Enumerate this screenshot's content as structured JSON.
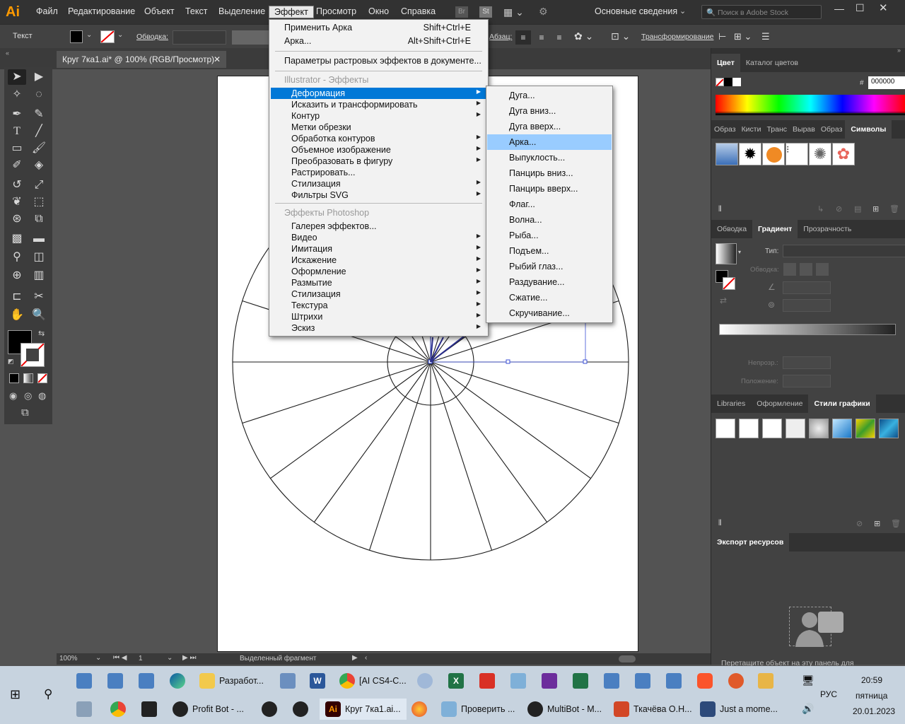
{
  "app": {
    "logo": "Ai"
  },
  "menubar": {
    "items": [
      "Файл",
      "Редактирование",
      "Объект",
      "Текст",
      "Выделение",
      "Эффект",
      "Просмотр",
      "Окно",
      "Справка"
    ],
    "workspace": "Основные сведения",
    "search_placeholder": "Поиск в Adobe Stock"
  },
  "control": {
    "mode_label": "Текст",
    "stroke_label": "Обводка:",
    "paragraph_label": "Абзац:",
    "transform_label": "Трансформирование"
  },
  "document": {
    "tab_title": "Круг 7ка1.ai* @ 100% (RGB/Просмотр)",
    "zoom": "100%",
    "page": "1",
    "status_text": "Выделенный фрагмент"
  },
  "effect_menu": {
    "apply_label": "Применить Арка",
    "apply_shortcut": "Shift+Ctrl+E",
    "last_label": "Арка...",
    "last_shortcut": "Alt+Shift+Ctrl+E",
    "raster_settings": "Параметры растровых эффектов в документе...",
    "illustrator_header": "Illustrator - Эффекты",
    "illustrator_items": [
      "Деформация",
      "Исказить и трансформировать",
      "Контур",
      "Метки обрезки",
      "Обработка контуров",
      "Объемное изображение",
      "Преобразовать в фигуру",
      "Растрировать...",
      "Стилизация",
      "Фильтры SVG"
    ],
    "photoshop_header": "Эффекты Photoshop",
    "photoshop_items": [
      "Галерея эффектов...",
      "Видео",
      "Имитация",
      "Искажение",
      "Оформление",
      "Размытие",
      "Стилизация",
      "Текстура",
      "Штрихи",
      "Эскиз"
    ]
  },
  "warp_submenu": {
    "items": [
      "Дуга...",
      "Дуга вниз...",
      "Дуга вверх...",
      "Арка...",
      "Выпуклость...",
      "Панцирь вниз...",
      "Панцирь вверх...",
      "Флаг...",
      "Волна...",
      "Рыба...",
      "Подъем...",
      "Рыбий глаз...",
      "Раздувание...",
      "Сжатие...",
      "Скручивание..."
    ],
    "highlighted": "Арка..."
  },
  "panels": {
    "color_tabs": [
      "Цвет",
      "Каталог цветов"
    ],
    "hex_value": "000000",
    "symbols_tabs": [
      "Образ",
      "Кисти",
      "Транс",
      "Вырав",
      "Образ",
      "Символы"
    ],
    "gradient_tabs": [
      "Обводка",
      "Градиент",
      "Прозрачность"
    ],
    "gradient_type_label": "Тип:",
    "gradient_stroke_label": "Обводка:",
    "opacity_label": "Непрозр.:",
    "location_label": "Положение:",
    "styles_tabs": [
      "Libraries",
      "Оформление",
      "Стили графики"
    ],
    "export_tab": "Экспорт ресурсов",
    "export_hint": "Перетащите объект на эту панель для"
  },
  "taskbar": {
    "row1": [
      "Разработ...",
      "[AI CS4-C..."
    ],
    "row2": [
      "Profit Bot - ...",
      "Круг 7ка1.ai...",
      "Проверить ...",
      "MultiBot - M...",
      "Ткачёва О.Н...",
      "Just a mome..."
    ],
    "lang": "РУС",
    "time": "20:59",
    "weekday": "пятница",
    "date": "20.01.2023"
  },
  "colors": {
    "accent": "#0078d7",
    "menu_bg": "#f2f2f2",
    "submenu_highlight": "#99ccff",
    "ui_dark": "#323232",
    "canvas": "#535353",
    "warp_line": "#2b2f8f"
  }
}
